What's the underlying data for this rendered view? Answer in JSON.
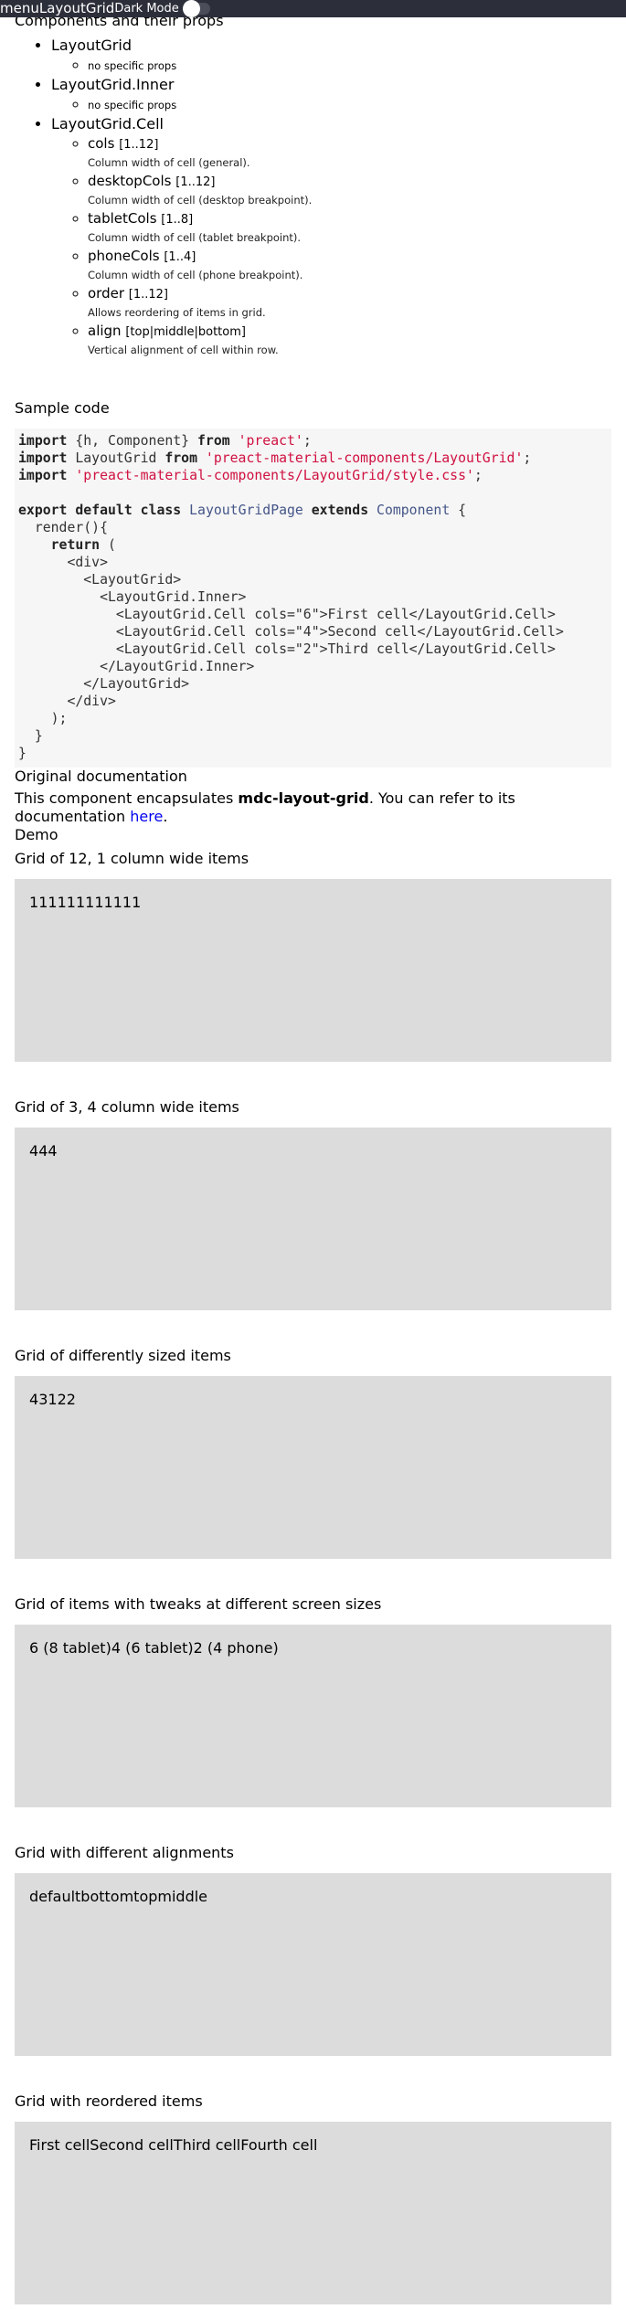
{
  "topbar": {
    "menu_label": "menu",
    "title": "LayoutGrid",
    "dark_mode_label": "Dark Mode"
  },
  "components": {
    "heading": "Components and their props",
    "items": [
      {
        "name": "LayoutGrid",
        "props": [
          {
            "note": "no specific props"
          }
        ]
      },
      {
        "name": "LayoutGrid.Inner",
        "props": [
          {
            "note": "no specific props"
          }
        ]
      },
      {
        "name": "LayoutGrid.Cell",
        "props": [
          {
            "name": "cols",
            "range": "[1..12]",
            "desc": "Column width of cell (general)."
          },
          {
            "name": "desktopCols",
            "range": "[1..12]",
            "desc": "Column width of cell (desktop breakpoint)."
          },
          {
            "name": "tabletCols",
            "range": "[1..8]",
            "desc": "Column width of cell (tablet breakpoint)."
          },
          {
            "name": "phoneCols",
            "range": "[1..4]",
            "desc": "Column width of cell (phone breakpoint)."
          },
          {
            "name": "order",
            "range": "[1..12]",
            "desc": "Allows reordering of items in grid."
          },
          {
            "name": "align",
            "range": "[top|middle|bottom]",
            "desc": "Vertical alignment of cell within row."
          }
        ]
      }
    ]
  },
  "sample_code": {
    "heading": "Sample code",
    "lines": [
      [
        {
          "t": "import",
          "c": "kw"
        },
        {
          "t": " {h, Component} "
        },
        {
          "t": "from",
          "c": "kw"
        },
        {
          "t": " "
        },
        {
          "t": "'preact'",
          "c": "str"
        },
        {
          "t": ";"
        }
      ],
      [
        {
          "t": "import",
          "c": "kw"
        },
        {
          "t": " LayoutGrid "
        },
        {
          "t": "from",
          "c": "kw"
        },
        {
          "t": " "
        },
        {
          "t": "'preact-material-components/LayoutGrid'",
          "c": "str"
        },
        {
          "t": ";"
        }
      ],
      [
        {
          "t": "import",
          "c": "kw"
        },
        {
          "t": " "
        },
        {
          "t": "'preact-material-components/LayoutGrid/style.css'",
          "c": "str"
        },
        {
          "t": ";"
        }
      ],
      [
        {
          "t": ""
        }
      ],
      [
        {
          "t": "export",
          "c": "kw"
        },
        {
          "t": " "
        },
        {
          "t": "default",
          "c": "kw"
        },
        {
          "t": " "
        },
        {
          "t": "class",
          "c": "kw"
        },
        {
          "t": " "
        },
        {
          "t": "LayoutGridPage",
          "c": "cls"
        },
        {
          "t": " "
        },
        {
          "t": "extends",
          "c": "kw"
        },
        {
          "t": " "
        },
        {
          "t": "Component",
          "c": "cls"
        },
        {
          "t": " {"
        }
      ],
      [
        {
          "t": "  render(){"
        }
      ],
      [
        {
          "t": "    "
        },
        {
          "t": "return",
          "c": "kw"
        },
        {
          "t": " ("
        }
      ],
      [
        {
          "t": "      <div>"
        }
      ],
      [
        {
          "t": "        <LayoutGrid>"
        }
      ],
      [
        {
          "t": "          <LayoutGrid.Inner>"
        }
      ],
      [
        {
          "t": "            <LayoutGrid.Cell cols=\"6\">First cell</LayoutGrid.Cell>"
        }
      ],
      [
        {
          "t": "            <LayoutGrid.Cell cols=\"4\">Second cell</LayoutGrid.Cell>"
        }
      ],
      [
        {
          "t": "            <LayoutGrid.Cell cols=\"2\">Third cell</LayoutGrid.Cell>"
        }
      ],
      [
        {
          "t": "          </LayoutGrid.Inner>"
        }
      ],
      [
        {
          "t": "        </LayoutGrid>"
        }
      ],
      [
        {
          "t": "      </div>"
        }
      ],
      [
        {
          "t": "    );"
        }
      ],
      [
        {
          "t": "  }"
        }
      ],
      [
        {
          "t": "}"
        }
      ]
    ]
  },
  "original_docs": {
    "heading": "Original documentation",
    "text_before": "This component encapsulates ",
    "component": "mdc-layout-grid",
    "text_after": ". You can refer to its documentation ",
    "link_label": "here",
    "text_end": "."
  },
  "demo": {
    "heading": "Demo",
    "grids": [
      {
        "title": "Grid of 12, 1 column wide items",
        "cells": [
          "1",
          "1",
          "1",
          "1",
          "1",
          "1",
          "1",
          "1",
          "1",
          "1",
          "1",
          "1"
        ]
      },
      {
        "title": "Grid of 3, 4 column wide items",
        "cells": [
          "4",
          "4",
          "4"
        ]
      },
      {
        "title": "Grid of differently sized items",
        "cells": [
          "4",
          "3",
          "1",
          "2",
          "2"
        ]
      },
      {
        "title": "Grid of items with tweaks at different screen sizes",
        "cells": [
          "6 (8 tablet)",
          "4 (6 tablet)",
          "2 (4 phone)"
        ]
      },
      {
        "title": "Grid with different alignments",
        "cells": [
          "default",
          "bottom",
          "top",
          "middle"
        ]
      },
      {
        "title": "Grid with reordered items",
        "cells": [
          "First cell",
          "Second cell",
          "Third cell",
          "Fourth cell"
        ]
      }
    ]
  },
  "colors": {
    "topbar_bg": "#2c2f3a",
    "grid_bg": "#dcdcdc",
    "code_bg": "#f6f6f6",
    "code_string": "#d01040",
    "code_class": "#445588",
    "link": "#0000ee"
  }
}
